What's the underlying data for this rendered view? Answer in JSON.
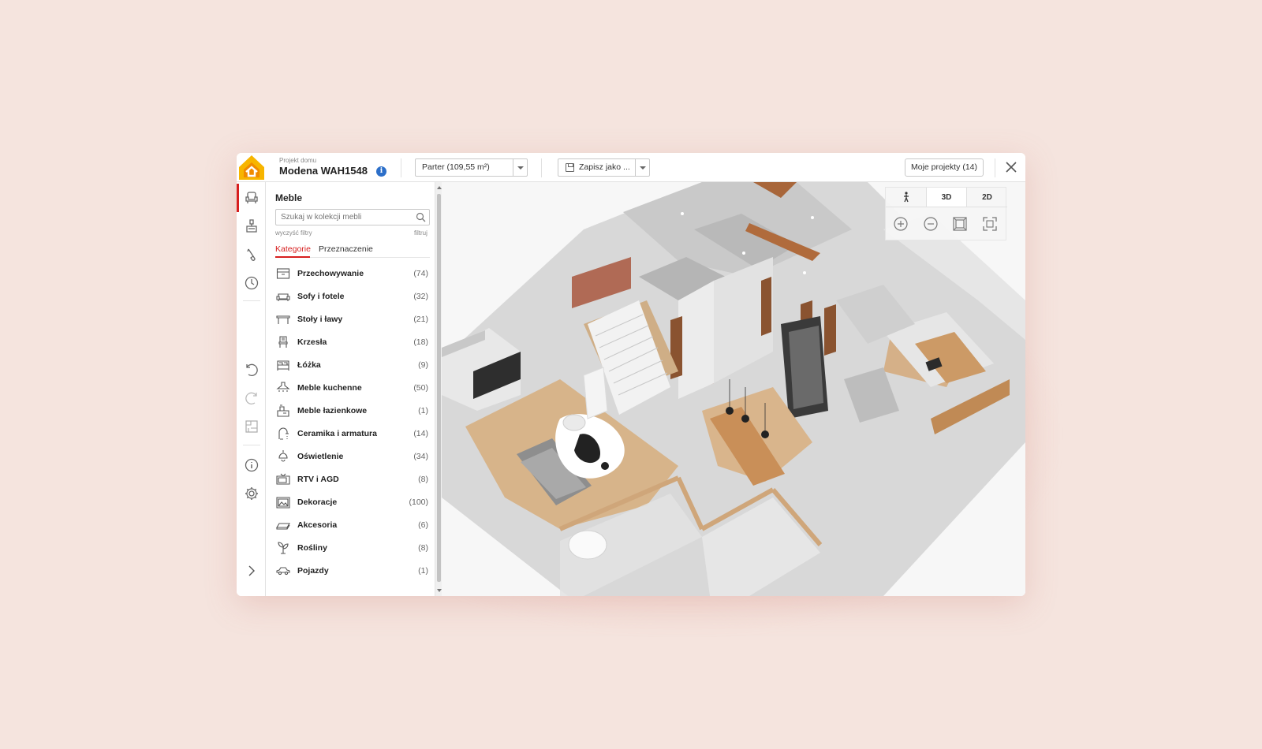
{
  "header": {
    "project_label": "Projekt domu",
    "project_name": "Modena WAH1548",
    "info_icon": "i",
    "floor_select": "Parter (109,55 m²)",
    "save_label": "Zapisz jako ...",
    "my_projects": "Moje projekty (14)"
  },
  "panel": {
    "title": "Meble",
    "search_placeholder": "Szukaj w kolekcji mebli",
    "clear_filters": "wyczyść filtry",
    "filter": "filtruj",
    "tabs": [
      "Kategorie",
      "Przeznaczenie"
    ],
    "categories": [
      {
        "label": "Przechowywanie",
        "count": "(74)",
        "icon": "storage-box-icon"
      },
      {
        "label": "Sofy i fotele",
        "count": "(32)",
        "icon": "sofa-icon"
      },
      {
        "label": "Stoły i ławy",
        "count": "(21)",
        "icon": "table-icon"
      },
      {
        "label": "Krzesła",
        "count": "(18)",
        "icon": "chair-icon"
      },
      {
        "label": "Łóżka",
        "count": "(9)",
        "icon": "bed-icon"
      },
      {
        "label": "Meble kuchenne",
        "count": "(50)",
        "icon": "kitchen-hood-icon"
      },
      {
        "label": "Meble łazienkowe",
        "count": "(1)",
        "icon": "bathroom-icon"
      },
      {
        "label": "Ceramika i armatura",
        "count": "(14)",
        "icon": "faucet-icon"
      },
      {
        "label": "Oświetlenie",
        "count": "(34)",
        "icon": "lamp-icon"
      },
      {
        "label": "RTV i AGD",
        "count": "(8)",
        "icon": "tv-icon"
      },
      {
        "label": "Dekoracje",
        "count": "(100)",
        "icon": "picture-frame-icon"
      },
      {
        "label": "Akcesoria",
        "count": "(6)",
        "icon": "rug-icon"
      },
      {
        "label": "Rośliny",
        "count": "(8)",
        "icon": "plant-icon"
      },
      {
        "label": "Pojazdy",
        "count": "(1)",
        "icon": "car-icon"
      }
    ]
  },
  "view": {
    "modes": [
      "3D",
      "2D"
    ],
    "walk_icon": "walk-icon",
    "zoom_icons": [
      "zoom-in-icon",
      "zoom-out-icon",
      "fit-view-icon",
      "fullscreen-icon"
    ]
  },
  "colors": {
    "accent": "#d71f1f",
    "logo_yellow": "#f7b500",
    "logo_orange": "#f08a00",
    "info_blue": "#2c6fc9",
    "background": "#f5e4de"
  }
}
